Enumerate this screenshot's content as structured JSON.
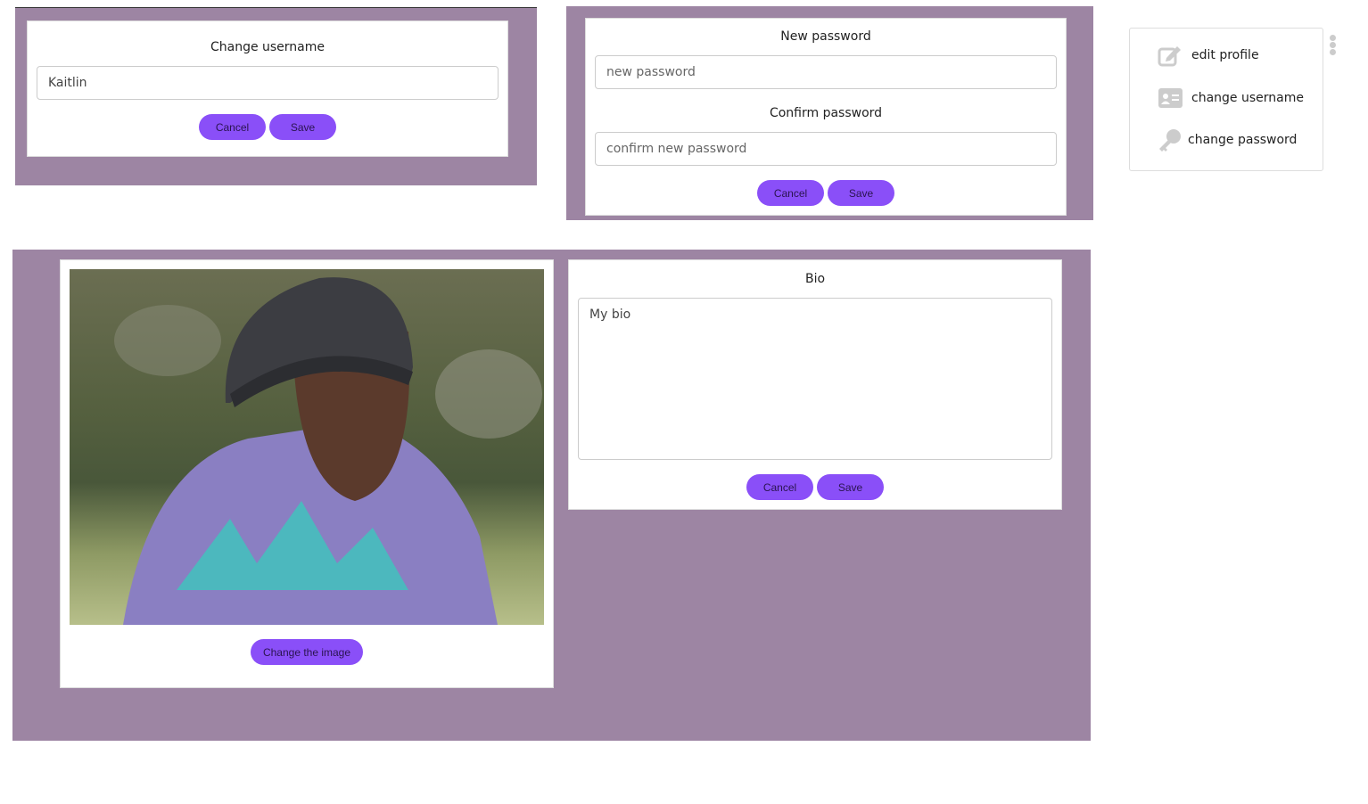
{
  "username_dialog": {
    "title": "Change username",
    "value": "Kaitlin",
    "cancel": "Cancel",
    "save": "Save"
  },
  "password_dialog": {
    "new_label": "New password",
    "new_placeholder": "new password",
    "confirm_label": "Confirm password",
    "confirm_placeholder": "confirm new password",
    "cancel": "Cancel",
    "save": "Save"
  },
  "menu": {
    "items": [
      {
        "label": "edit profile",
        "icon": "edit-icon"
      },
      {
        "label": "change username",
        "icon": "id-card-icon"
      },
      {
        "label": "change password",
        "icon": "key-icon"
      }
    ]
  },
  "image_card": {
    "change_image": "Change the image"
  },
  "bio_card": {
    "title": "Bio",
    "value": "My bio",
    "cancel": "Cancel",
    "save": "Save"
  },
  "colors": {
    "panel": "#9d85a3",
    "button": "#8a4ff8"
  }
}
